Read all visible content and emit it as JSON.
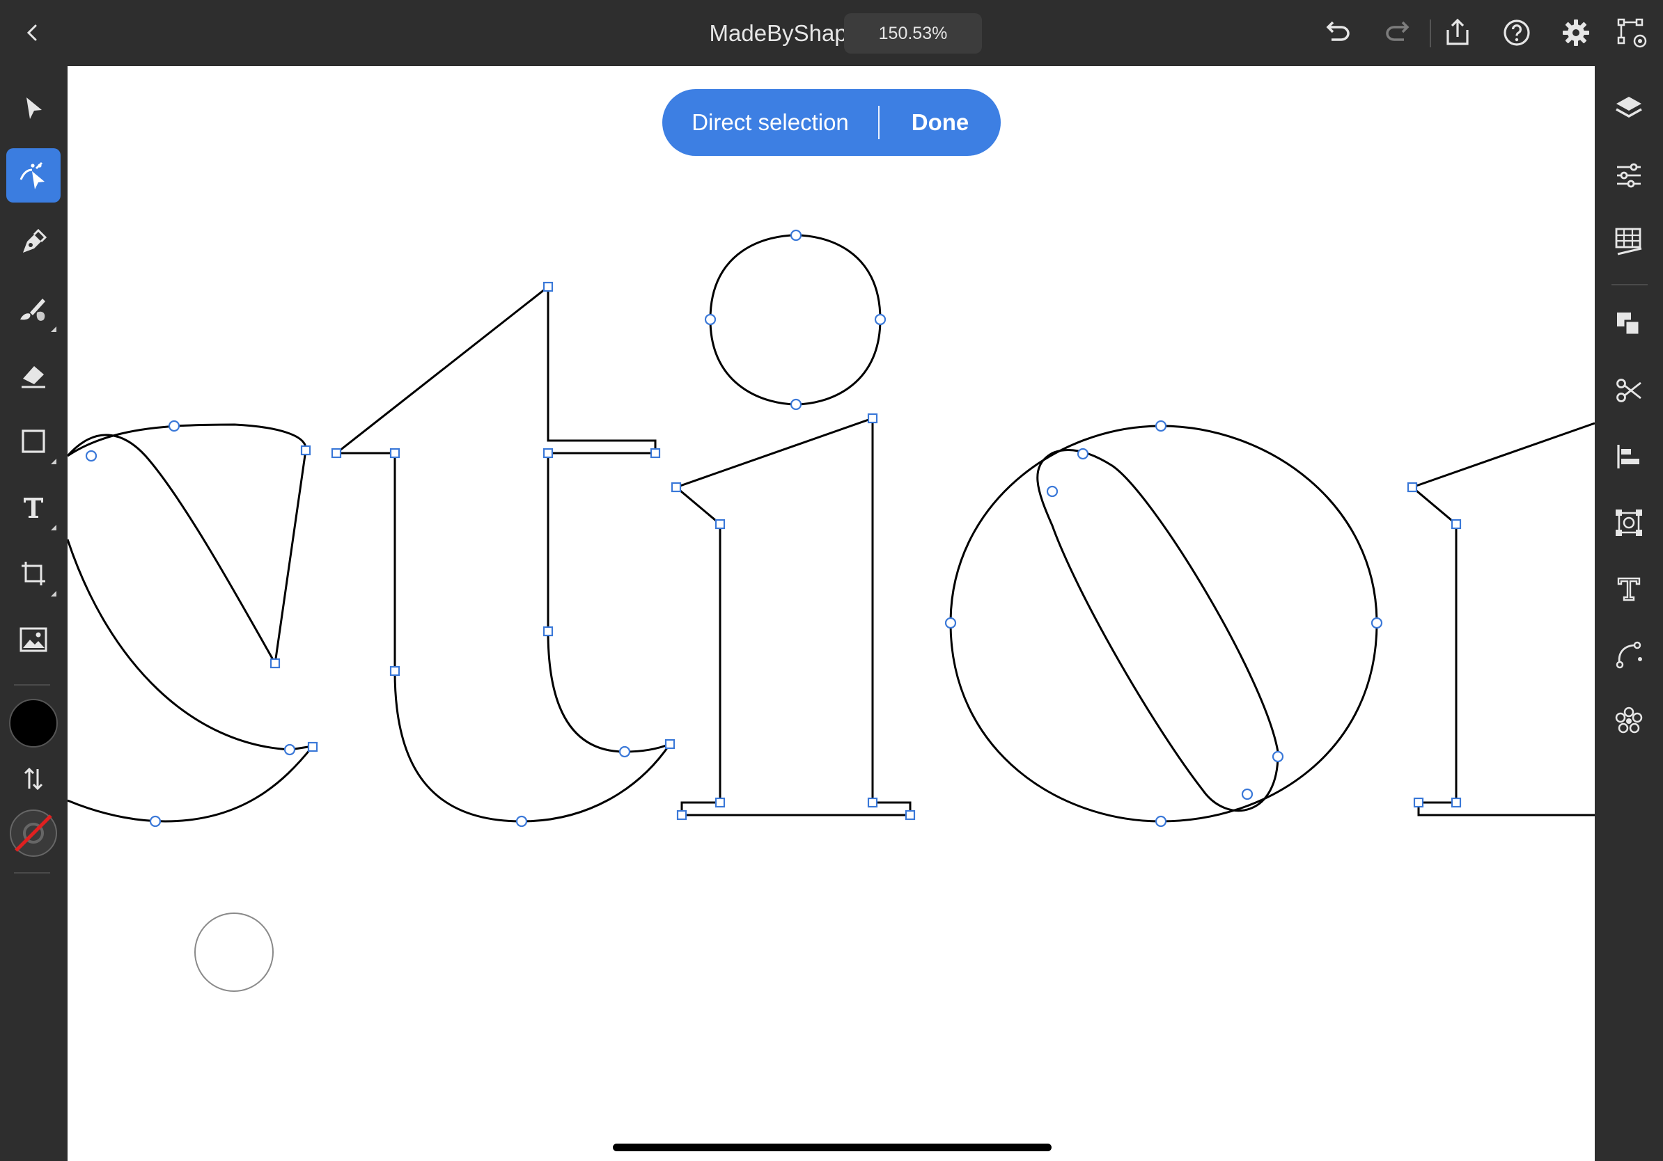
{
  "app": {
    "document_title": "MadeByShape",
    "zoom_level": "150.53%"
  },
  "mode_pill": {
    "label": "Direct selection",
    "done_label": "Done"
  },
  "top_icons": [
    "back-chevron-icon",
    "undo-icon",
    "redo-icon",
    "share-icon",
    "help-icon",
    "settings-gear-icon",
    "touch-shortcut-icon"
  ],
  "left_tools": [
    "selection-arrow-icon",
    "direct-selection-icon",
    "pen-icon",
    "brush-icon",
    "eraser-icon",
    "rectangle-icon",
    "type-icon",
    "crop-transform-icon",
    "image-icon",
    "fill-color-swatch",
    "swap-colors-icon",
    "stroke-none-swatch"
  ],
  "right_tools": [
    "layers-icon",
    "properties-sliders-icon",
    "appearance-grid-icon",
    "arrange-icon",
    "scissors-icon",
    "align-icon",
    "transform-icon",
    "text-properties-icon",
    "path-icon",
    "repeat-icon"
  ],
  "colors": {
    "accent": "#3d7fe3",
    "toolbar_bg": "#2e2e2e",
    "canvas_bg": "#ffffff",
    "fill_swatch": "#000000",
    "stroke_none_slash": "#e02020",
    "anchor_point": "#3a78d8"
  }
}
